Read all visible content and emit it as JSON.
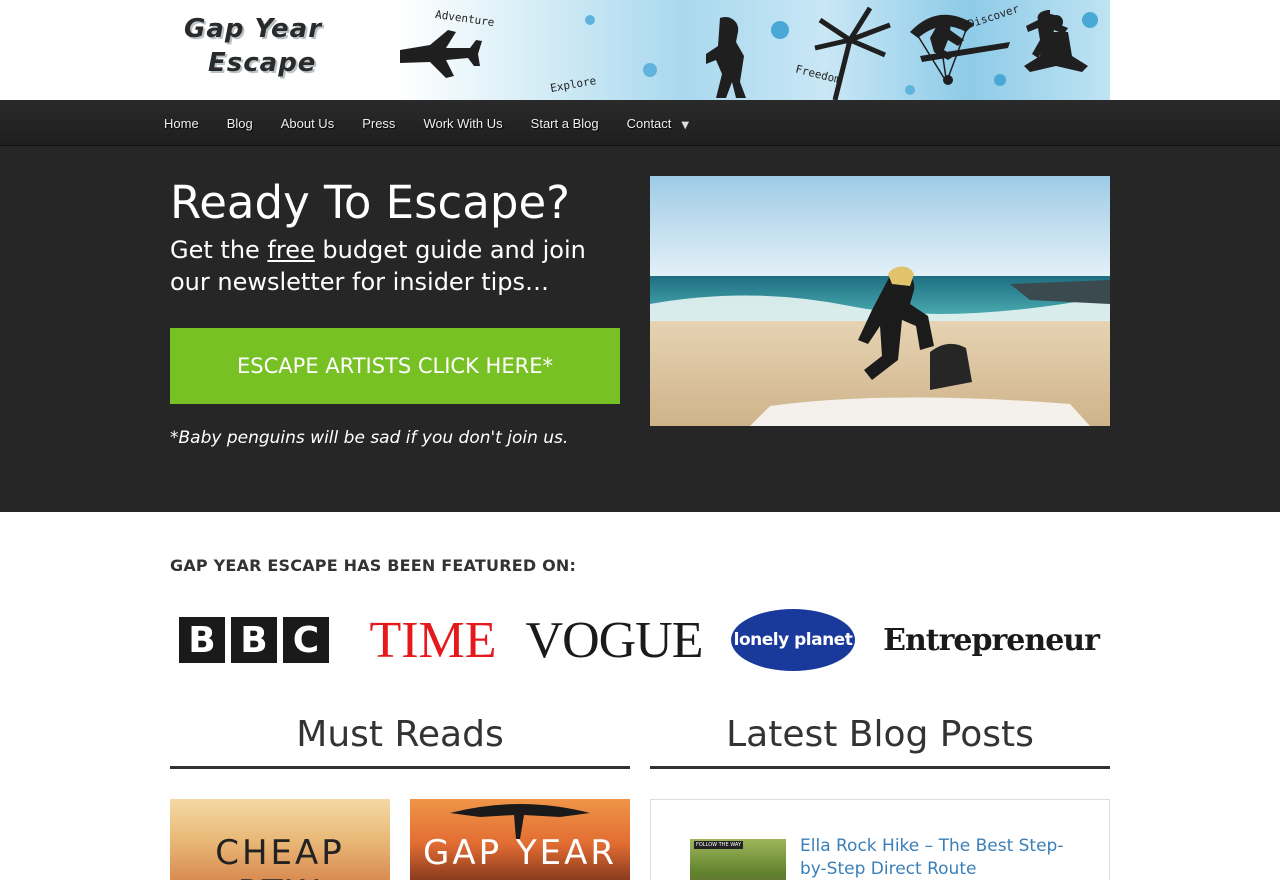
{
  "header": {
    "logo_line1": "Gap Year",
    "logo_line2": "Escape",
    "banner_words": {
      "adventure": "Adventure",
      "explore": "Explore",
      "freedom": "Freedom",
      "discover": "Discover"
    }
  },
  "nav": {
    "items": [
      {
        "label": "Home"
      },
      {
        "label": "Blog"
      },
      {
        "label": "About Us"
      },
      {
        "label": "Press"
      },
      {
        "label": "Work With Us"
      },
      {
        "label": "Start a Blog"
      },
      {
        "label": "Contact"
      }
    ],
    "caret": "▼"
  },
  "hero": {
    "title": "Ready To Escape?",
    "subtitle_before": "Get the ",
    "subtitle_emph": "free",
    "subtitle_after": " budget guide and join our newsletter for insider tips…",
    "cta_label": "ESCAPE ARTISTS CLICK HERE*",
    "note": "*Baby penguins will be sad if you don't join us.",
    "image_alt": "beach-photo"
  },
  "featured": {
    "title": "GAP YEAR ESCAPE HAS BEEN FEATURED ON:",
    "logos": {
      "bbc": [
        "B",
        "B",
        "C"
      ],
      "time": "TIME",
      "vogue": "VOGUE",
      "lonely_planet": "lonely planet",
      "entrepreneur": "Entrepreneur"
    }
  },
  "must_reads": {
    "heading": "Must Reads",
    "items": [
      {
        "text": "CHEAP RTW"
      },
      {
        "text": "GAP YEAR"
      }
    ]
  },
  "latest_posts": {
    "heading": "Latest Blog Posts",
    "posts": [
      {
        "title": "Ella Rock Hike – The Best Step-by-Step Direct Route",
        "thumb_label": "FOLLOW THE WAY"
      }
    ]
  },
  "colors": {
    "nav_bg": "#222222",
    "hero_bg": "#262626",
    "cta_green": "#77c124",
    "link_blue": "#3a7fb8",
    "time_red": "#e4191c",
    "lonely_blue": "#1a3a9b"
  }
}
